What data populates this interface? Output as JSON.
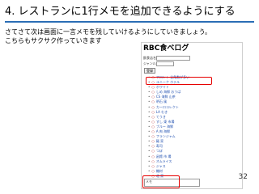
{
  "slide": {
    "title": "4. レストランに1行メモを追加できるようにする",
    "body_lines": [
      "さてさて次は画面に一言メモを残していけるようにしていきましょう。",
      "こちらもサクサク作っていきます"
    ],
    "page_number": "32",
    "accent_color": "#2a6db5",
    "highlight_color": "#e60000"
  },
  "screenshot": {
    "title": "RBC食べログ",
    "form": {
      "name_label": "飲食店名",
      "category_label": "ジャンル",
      "button_label": "登録"
    },
    "items": [
      "フロント 全角数が多い",
      "ユニーク ホテル",
      "ホワイト",
      "しめ 海鮮 おうば",
      "CS 海鮮 山茶",
      "明石 風",
      "カーロコレクト",
      "LA むき",
      "てうき",
      "すし 東 市場",
      "ブルー 海鮮",
      "A 肉 海鮮",
      "フランジャム",
      "麺 家",
      "寿司",
      "つぼ",
      "函館 市 場",
      "オムライス",
      "ジャス",
      "機材",
      "北 家"
    ],
    "memo_label": "メモ"
  }
}
